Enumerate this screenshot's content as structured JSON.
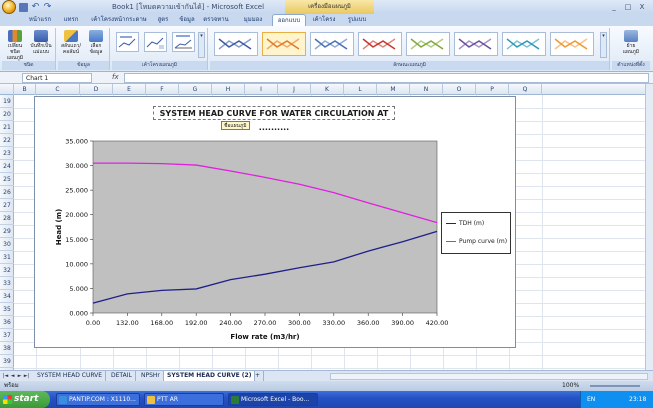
{
  "window": {
    "title": "Book1 [โหมดความเข้ากันได้] - Microsoft Excel",
    "context_group": "เครื่องมือแผนภูมิ",
    "controls": [
      "_",
      "□",
      "X"
    ]
  },
  "ribbon": {
    "tabs": [
      "หน้าแรก",
      "แทรก",
      "เค้าโครงหน้ากระดาษ",
      "สูตร",
      "ข้อมูล",
      "ตรวจทาน",
      "มุมมอง",
      "ออกแบบ",
      "เค้าโครง",
      "รูปแบบ"
    ],
    "active_tab": "ออกแบบ",
    "groups": [
      {
        "label": "ชนิด",
        "buttons": [
          "เปลี่ยนชนิดแผนภูมิ",
          "บันทึกเป็นแม่แบบ"
        ]
      },
      {
        "label": "ข้อมูล",
        "buttons": [
          "สลับแถว/คอลัมน์",
          "เลือกข้อมูล"
        ]
      },
      {
        "label": "เค้าโครงแผนภูมิ",
        "buttons": []
      },
      {
        "label": "ลักษณะแผนภูมิ",
        "buttons": []
      },
      {
        "label": "ตำแหน่งที่ตั้ง",
        "buttons": [
          "ย้ายแผนภูมิ"
        ]
      }
    ],
    "style_colors": [
      "#3b5ba8",
      "#e07a2a",
      "#4870b8",
      "#c8342c",
      "#80a838",
      "#6a4ea0",
      "#2a98b8",
      "#f09830"
    ]
  },
  "formula_bar": {
    "name_box": "Chart 1",
    "fx": "fx",
    "value": ""
  },
  "columns": [
    "B",
    "C",
    "D",
    "E",
    "F",
    "G",
    "H",
    "I",
    "J",
    "K",
    "L",
    "M",
    "N",
    "O",
    "P",
    "Q"
  ],
  "rows": [
    "19",
    "20",
    "21",
    "22",
    "23",
    "24",
    "25",
    "26",
    "27",
    "28",
    "29",
    "30",
    "31",
    "32",
    "33",
    "34",
    "35",
    "36",
    "37",
    "38",
    "39"
  ],
  "chart": {
    "title": "SYSTEM HEAD CURVE FOR WATER CIRCULATION AT ..........",
    "tooltip": "ชื่อแผนภูมิ",
    "legend": [
      "TDH (m)",
      "Pump curve (m)"
    ]
  },
  "chart_data": {
    "type": "line",
    "title": "SYSTEM HEAD CURVE FOR WATER CIRCULATION AT ..........",
    "xlabel": "Flow rate (m3/hr)",
    "ylabel": "Head (m)",
    "categories": [
      "0.00",
      "132.00",
      "168.00",
      "192.00",
      "240.00",
      "270.00",
      "300.00",
      "330.00",
      "360.00",
      "390.00",
      "420.00"
    ],
    "series": [
      {
        "name": "TDH (m)",
        "color": "#1f1f8a",
        "values": [
          2.0,
          3.9,
          4.6,
          4.9,
          6.8,
          7.9,
          9.2,
          10.4,
          12.6,
          14.5,
          16.6
        ]
      },
      {
        "name": "Pump curve (m)",
        "color": "#e020e0",
        "values": [
          30.5,
          30.5,
          30.4,
          30.1,
          28.9,
          27.6,
          26.2,
          24.5,
          22.4,
          20.4,
          18.4
        ]
      }
    ],
    "y_ticks": [
      "0.000",
      "5.000",
      "10.000",
      "15.000",
      "20.000",
      "25.000",
      "30.000",
      "35.000"
    ],
    "ylim": [
      0,
      35
    ],
    "plot_background": "#c0c0c0",
    "grid": false,
    "legend_position": "right"
  },
  "sheets": {
    "tabs": [
      "SYSTEM HEAD CURVE",
      "DETAIL",
      "NPSHr",
      "SYSTEM HEAD CURVE (2)"
    ],
    "active": "SYSTEM HEAD CURVE (2)",
    "nav": [
      "|◄",
      "◄",
      "►",
      "►|"
    ]
  },
  "status": {
    "ready": "พร้อม",
    "zoom": "100%"
  },
  "taskbar": {
    "start": "start",
    "items": [
      {
        "label": "PANTIP.COM : X1110...",
        "color": "#3a8ee0"
      },
      {
        "label": "PTT AR",
        "color": "#f0c040"
      },
      {
        "label": "Microsoft Excel - Boo...",
        "color": "#2a7a3a"
      }
    ],
    "lang": "EN",
    "clock": "23:18"
  }
}
